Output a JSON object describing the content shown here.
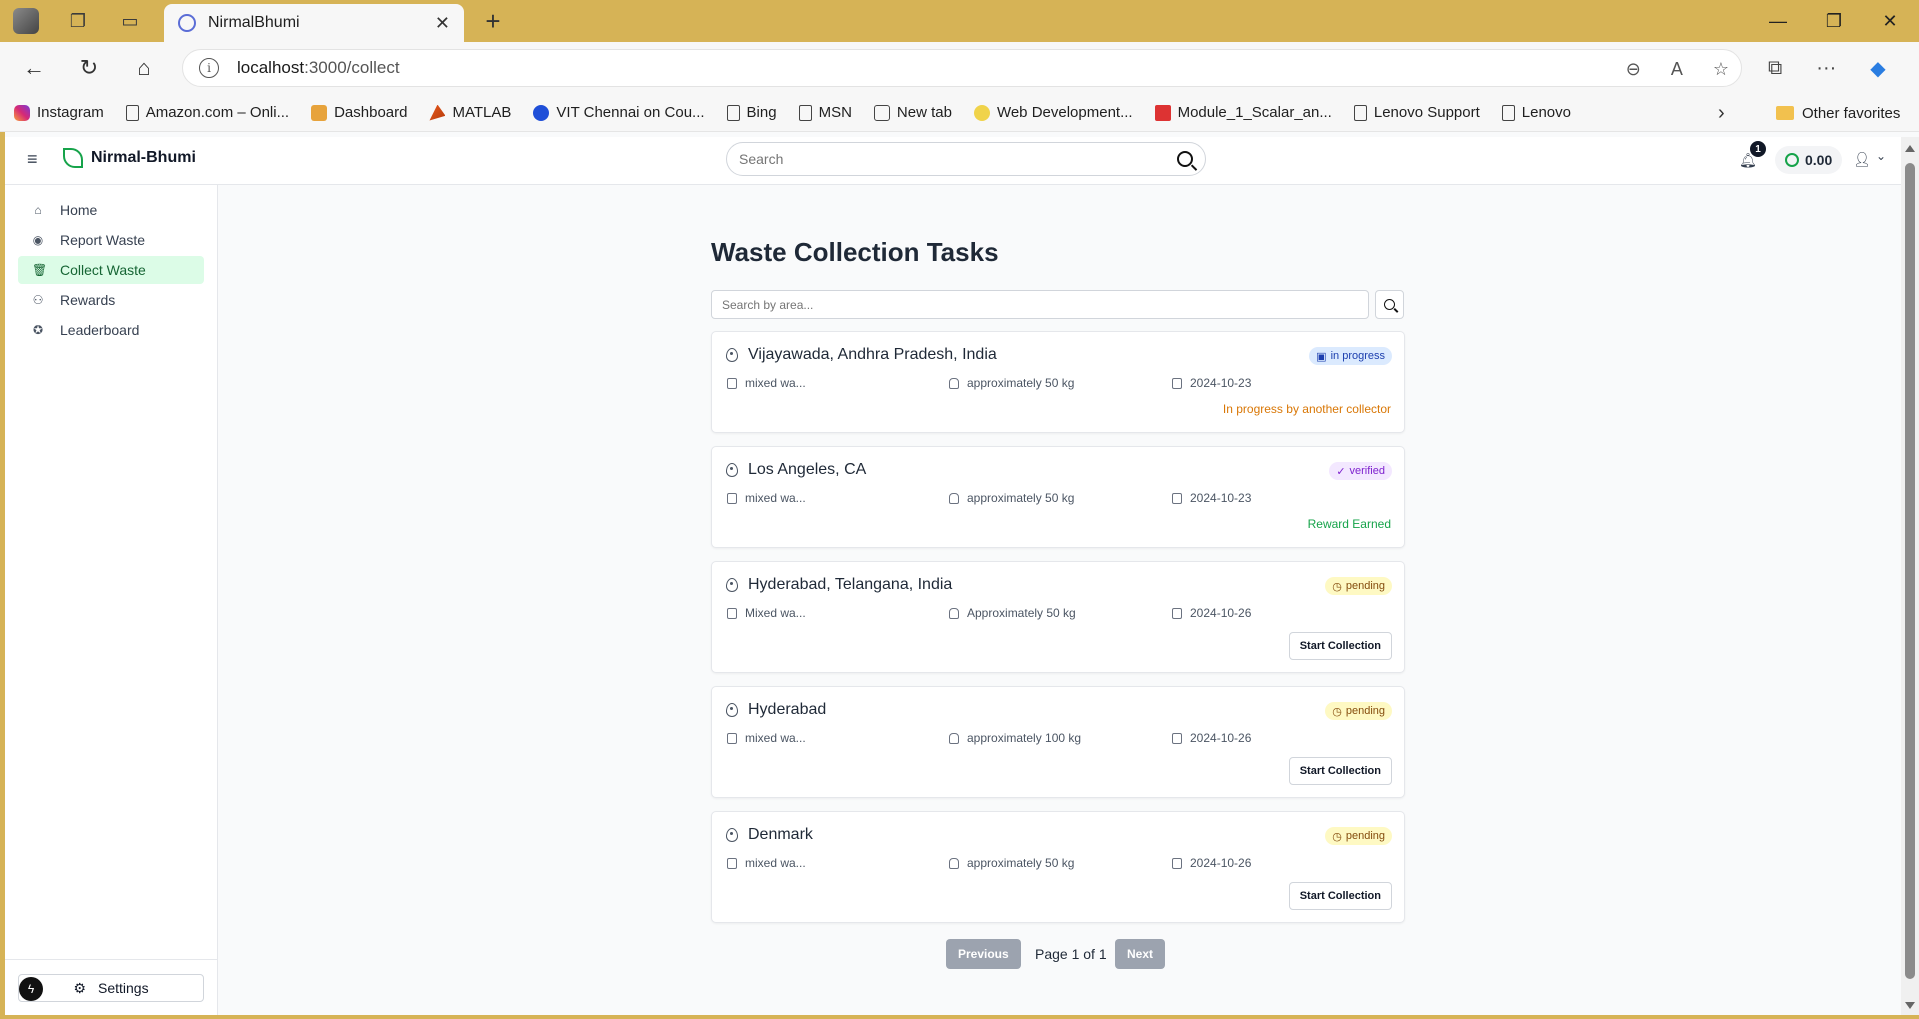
{
  "browser": {
    "tab_title": "NirmalBhumi",
    "url_host": "localhost",
    "url_rest": ":3000/collect",
    "bookmarks": [
      {
        "label": "Instagram",
        "icon": "instagram-icon"
      },
      {
        "label": "Amazon.com – Onli...",
        "icon": "page-icon"
      },
      {
        "label": "Dashboard",
        "icon": "dashboard-icon"
      },
      {
        "label": "MATLAB",
        "icon": "matlab-icon"
      },
      {
        "label": "VIT Chennai on Cou...",
        "icon": "vit-icon"
      },
      {
        "label": "Bing",
        "icon": "page-icon"
      },
      {
        "label": "MSN",
        "icon": "page-icon"
      },
      {
        "label": "New tab",
        "icon": "calendar-icon"
      },
      {
        "label": "Web Development...",
        "icon": "web-icon"
      },
      {
        "label": "Module_1_Scalar_an...",
        "icon": "pdf-icon"
      },
      {
        "label": "Lenovo Support",
        "icon": "page-icon"
      },
      {
        "label": "Lenovo",
        "icon": "page-icon"
      }
    ],
    "other_favorites": "Other favorites"
  },
  "header": {
    "brand": "Nirmal-Bhumi",
    "search_placeholder": "Search",
    "notification_count": "1",
    "balance": "0.00"
  },
  "sidebar": {
    "items": [
      {
        "label": "Home",
        "icon": "home-icon",
        "active": false
      },
      {
        "label": "Report Waste",
        "icon": "map-pin-icon",
        "active": false
      },
      {
        "label": "Collect Waste",
        "icon": "trash-icon",
        "active": true
      },
      {
        "label": "Rewards",
        "icon": "coins-icon",
        "active": false
      },
      {
        "label": "Leaderboard",
        "icon": "medal-icon",
        "active": false
      }
    ],
    "settings_label": "Settings"
  },
  "main": {
    "title": "Waste Collection Tasks",
    "area_search_placeholder": "Search by area...",
    "tasks": [
      {
        "location": "Vijayawada, Andhra Pradesh, India",
        "status": "in progress",
        "waste_type": "mixed wa...",
        "amount": "approximately 50 kg",
        "date": "2024-10-23",
        "note": "In progress by another collector",
        "action": ""
      },
      {
        "location": "Los Angeles, CA",
        "status": "verified",
        "waste_type": "mixed wa...",
        "amount": "approximately 50 kg",
        "date": "2024-10-23",
        "note": "Reward Earned",
        "action": ""
      },
      {
        "location": "Hyderabad, Telangana, India",
        "status": "pending",
        "waste_type": "Mixed wa...",
        "amount": "Approximately 50 kg",
        "date": "2024-10-26",
        "note": "",
        "action": "Start Collection"
      },
      {
        "location": "Hyderabad",
        "status": "pending",
        "waste_type": "mixed wa...",
        "amount": "approximately 100 kg",
        "date": "2024-10-26",
        "note": "",
        "action": "Start Collection"
      },
      {
        "location": "Denmark",
        "status": "pending",
        "waste_type": "mixed wa...",
        "amount": "approximately 50 kg",
        "date": "2024-10-26",
        "note": "",
        "action": "Start Collection"
      }
    ],
    "pagination": {
      "previous": "Previous",
      "info": "Page 1 of 1",
      "next": "Next"
    }
  },
  "colors": {
    "accent_green": "#16a34a",
    "active_nav_bg": "#dcfce7",
    "in_progress_note": "#d97706",
    "browser_frame": "#d6b356"
  }
}
